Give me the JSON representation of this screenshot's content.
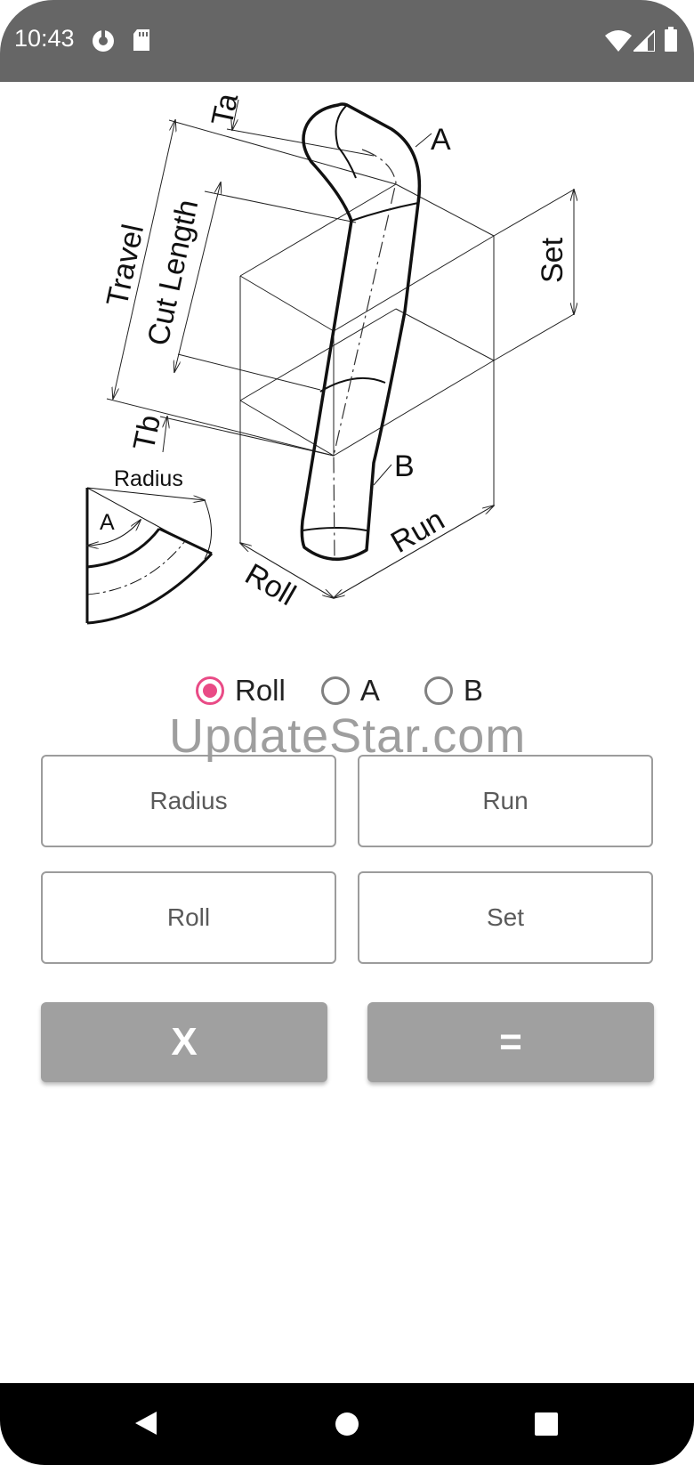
{
  "status": {
    "time": "10:43",
    "icons": [
      "data-saver-icon",
      "sd-card-icon",
      "wifi-icon",
      "cell-signal-icon",
      "battery-icon"
    ]
  },
  "diagram": {
    "labels": {
      "ta": "Ta",
      "a": "A",
      "travel": "Travel",
      "cut_length": "Cut Length",
      "set": "Set",
      "tb": "Tb",
      "b": "B",
      "radius": "Radius",
      "angle_a": "A",
      "run": "Run",
      "roll": "Roll"
    }
  },
  "options": {
    "selected": "Roll",
    "items": [
      {
        "label": "Roll",
        "checked": true
      },
      {
        "label": "A",
        "checked": false
      },
      {
        "label": "B",
        "checked": false
      }
    ]
  },
  "watermark": "UpdateStar.com",
  "inputs": {
    "radius_placeholder": "Radius",
    "run_placeholder": "Run",
    "roll_placeholder": "Roll",
    "set_placeholder": "Set"
  },
  "buttons": {
    "clear_label": "X",
    "calculate_label": "="
  },
  "colors": {
    "accent": "#e94b86",
    "status_bar": "#666666",
    "button": "#a0a0a0"
  }
}
